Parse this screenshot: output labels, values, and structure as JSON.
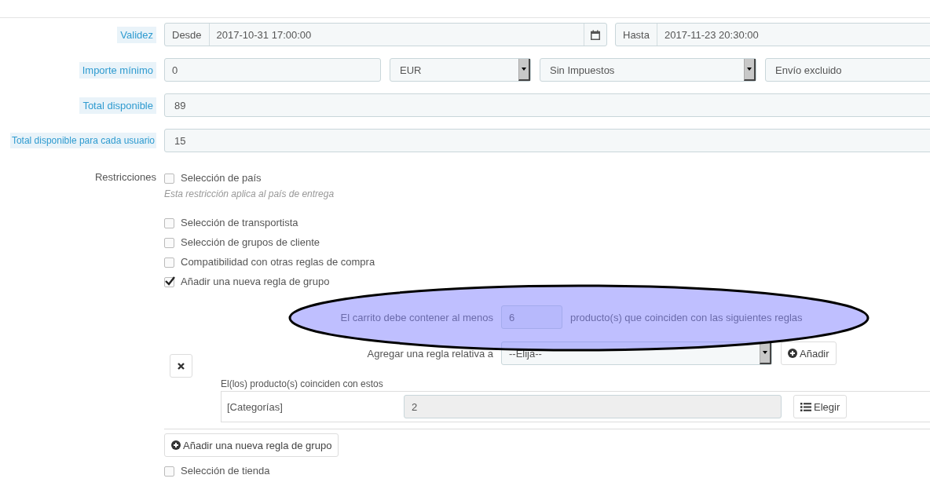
{
  "validity": {
    "label": "Validez",
    "from": {
      "addon": "Desde",
      "value": "2017-10-31 17:00:00"
    },
    "to": {
      "addon": "Hasta",
      "value": "2017-11-23 20:30:00"
    }
  },
  "minimum_amount": {
    "label": "Importe mínimo",
    "value": "0",
    "currency": "EUR",
    "tax": "Sin Impuestos",
    "shipping": "Envío excluido"
  },
  "total_available": {
    "label": "Total disponible",
    "value": "89"
  },
  "total_per_user": {
    "label": "Total disponible para cada usuario",
    "value": "15"
  },
  "restrictions": {
    "label": "Restricciones",
    "options": [
      {
        "label": "Selección de país",
        "checked": false,
        "help": "Esta restricción aplica al país de entrega"
      },
      {
        "label": "Selección de transportista",
        "checked": false
      },
      {
        "label": "Selección de grupos de cliente",
        "checked": false
      },
      {
        "label": "Compatibilidad con otras reglas de compra",
        "checked": false
      },
      {
        "label": "Añadir una nueva regla de grupo",
        "checked": true
      }
    ]
  },
  "group_rule": {
    "quantity_prefix": "El carrito debe contener al menos",
    "quantity": "6",
    "quantity_suffix": "producto(s) que coinciden con las siguientes reglas",
    "add_rule_label": "Agregar una regla relativa a",
    "add_rule_select": "--Elija--",
    "add_button": "Añadir",
    "match_label": "El(los) producto(s) coinciden con estos",
    "rules": [
      {
        "type": "[Categorías]",
        "value": "2",
        "button": "Elegir"
      }
    ]
  },
  "new_group_button": "Añadir una nueva regla de grupo",
  "shop_option": {
    "label": "Selección de tienda",
    "checked": false
  }
}
